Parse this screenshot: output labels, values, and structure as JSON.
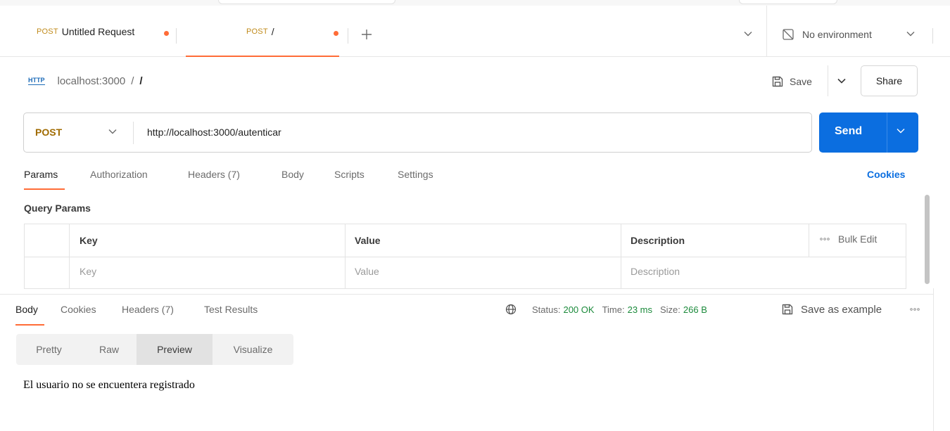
{
  "tabs": [
    {
      "method": "POST",
      "label": "Untitled Request"
    },
    {
      "method": "POST",
      "label": "/"
    }
  ],
  "environment": {
    "label": "No environment"
  },
  "breadcrumb": {
    "protocol": "HTTP",
    "collection": "localhost:3000",
    "separator": "/",
    "current": "/"
  },
  "actions": {
    "save": "Save",
    "share": "Share"
  },
  "request": {
    "method": "POST",
    "url": "http://localhost:3000/autenticar",
    "send": "Send"
  },
  "request_tabs": [
    "Params",
    "Authorization",
    "Headers (7)",
    "Body",
    "Scripts",
    "Settings"
  ],
  "cookies_link": "Cookies",
  "query_params": {
    "title": "Query Params",
    "headers": {
      "key": "Key",
      "value": "Value",
      "description": "Description",
      "bulk_edit": "Bulk Edit"
    },
    "placeholders": {
      "key": "Key",
      "value": "Value",
      "description": "Description"
    }
  },
  "response_tabs": [
    "Body",
    "Cookies",
    "Headers (7)",
    "Test Results"
  ],
  "response_meta": {
    "status_label": "Status:",
    "status_value": "200 OK",
    "time_label": "Time:",
    "time_value": "23 ms",
    "size_label": "Size:",
    "size_value": "266 B",
    "save_example": "Save as example"
  },
  "view_modes": [
    "Pretty",
    "Raw",
    "Preview",
    "Visualize"
  ],
  "view_selected": "Preview",
  "preview_text": "El usuario no se encuentera registrado",
  "colors": {
    "accent": "#ff6c37",
    "primary": "#0b6ee0",
    "success": "#1b8a3b",
    "method": "#a06b00"
  }
}
